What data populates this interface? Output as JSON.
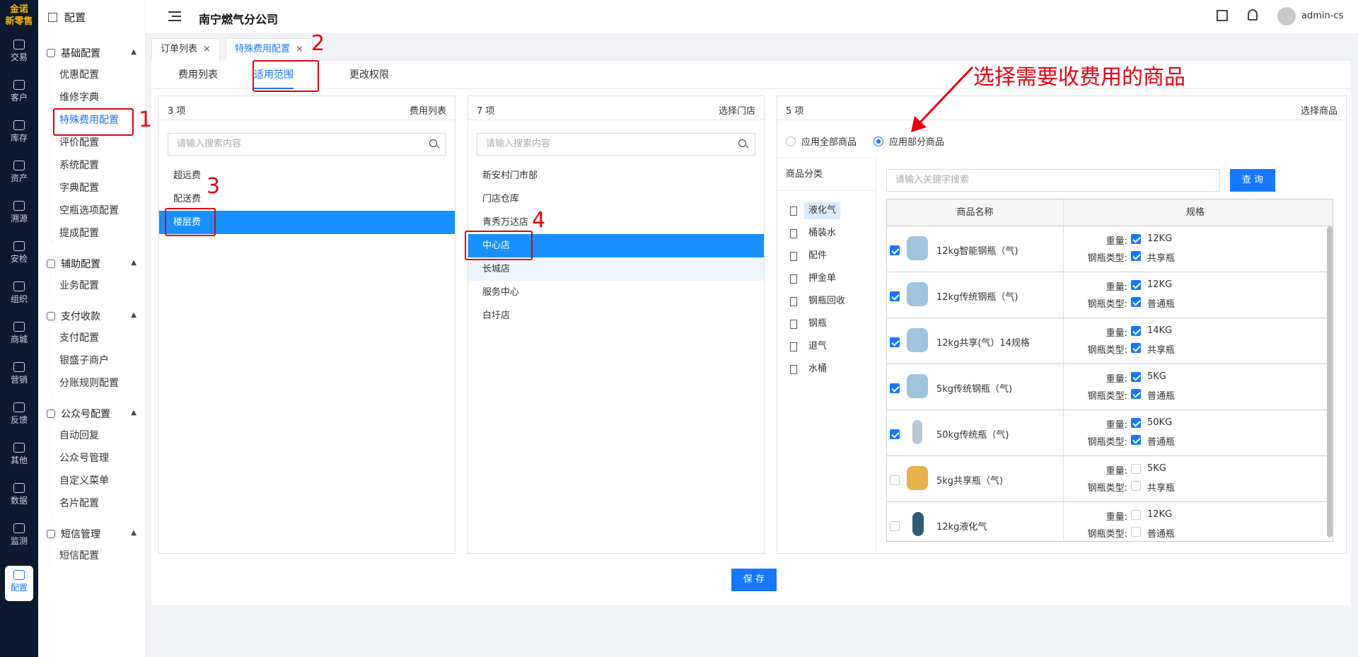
{
  "brand": {
    "line1": "金诺",
    "line2": "新零售"
  },
  "rail": [
    {
      "label": "交易",
      "icon": "bag-icon"
    },
    {
      "label": "客户",
      "icon": "person-card-icon"
    },
    {
      "label": "库存",
      "icon": "list-icon"
    },
    {
      "label": "资产",
      "icon": "bulb-icon"
    },
    {
      "label": "溯源",
      "icon": "compass-icon"
    },
    {
      "label": "安检",
      "icon": "shield-icon"
    },
    {
      "label": "组织",
      "icon": "org-icon"
    },
    {
      "label": "商城",
      "icon": "store-icon"
    },
    {
      "label": "营销",
      "icon": "trophy-icon"
    },
    {
      "label": "反馈",
      "icon": "chat-icon"
    },
    {
      "label": "其他",
      "icon": "grid-plus-icon"
    },
    {
      "label": "数据",
      "icon": "chart-icon"
    },
    {
      "label": "监测",
      "icon": "alarm-icon"
    },
    {
      "label": "配置",
      "icon": "grid-icon"
    }
  ],
  "menu": {
    "title": "配置",
    "groups": [
      {
        "label": "基础配置",
        "items": [
          "优惠配置",
          "维修字典",
          "特殊费用配置",
          "评价配置",
          "系统配置",
          "字典配置",
          "空瓶选项配置",
          "提成配置"
        ]
      },
      {
        "label": "辅助配置",
        "items": [
          "业务配置"
        ]
      },
      {
        "label": "支付收款",
        "items": [
          "支付配置",
          "银盛子商户",
          "分账规则配置"
        ]
      },
      {
        "label": "公众号配置",
        "items": [
          "自动回复",
          "公众号管理",
          "自定义菜单",
          "名片配置"
        ]
      },
      {
        "label": "短信管理",
        "items": [
          "短信配置"
        ]
      }
    ]
  },
  "header": {
    "company": "南宁燃气分公司",
    "user": "admin-cs"
  },
  "page_tabs": [
    {
      "label": "订单列表",
      "close": "×"
    },
    {
      "label": "特殊费用配置",
      "close": "×"
    }
  ],
  "sub_tabs": [
    "费用列表",
    "适用范围",
    "更改权限"
  ],
  "panel_fees": {
    "count": "3 项",
    "title": "费用列表",
    "placeholder": "请输入搜索内容",
    "items": [
      "超远费",
      "配送费",
      "楼层费"
    ]
  },
  "panel_stores": {
    "count": "7 项",
    "title": "选择门店",
    "placeholder": "请输入搜索内容",
    "items": [
      "新安村门市部",
      "门店仓库",
      "青秀万达店",
      "中心店",
      "长城店",
      "服务中心",
      "白圩店"
    ]
  },
  "panel_goods": {
    "count": "5 项",
    "title": "选择商品",
    "radio_all": "应用全部商品",
    "radio_part": "应用部分商品",
    "category_title": "商品分类",
    "categories": [
      "液化气",
      "桶装水",
      "配件",
      "押金单",
      "钢瓶回收",
      "钢瓶",
      "退气",
      "水桶"
    ],
    "keyword_placeholder": "请输入关键字搜索",
    "query_button": "查 询",
    "col_name": "商品名称",
    "col_spec": "规格",
    "weight_label": "重量:",
    "type_label": "钢瓶类型:",
    "products": [
      {
        "name": "12kg智能钢瓶（气)",
        "weight": "12KG",
        "type": "共享瓶",
        "checked": true
      },
      {
        "name": "12kg传统钢瓶（气)",
        "weight": "12KG",
        "type": "普通瓶",
        "checked": true
      },
      {
        "name": "12kg共享(气）14规格",
        "weight": "14KG",
        "type": "共享瓶",
        "checked": true
      },
      {
        "name": "5kg传统钢瓶（气)",
        "weight": "5KG",
        "type": "普通瓶",
        "checked": true
      },
      {
        "name": "50kg传统瓶（气)",
        "weight": "50KG",
        "type": "普通瓶",
        "checked": true
      },
      {
        "name": "5kg共享瓶（气)",
        "weight": "5KG",
        "type": "共享瓶",
        "checked": false
      },
      {
        "name": "12kg液化气",
        "weight": "12KG",
        "type": "普通瓶",
        "checked": false
      }
    ]
  },
  "save_label": "保 存",
  "annotations": {
    "n1": "1",
    "n2": "2",
    "n3": "3",
    "n4": "4",
    "note": "选择需要收费用的商品"
  },
  "colors": {
    "primary": "#1677ff",
    "annotation": "#e60012",
    "rail_bg": "#0b1a2e"
  }
}
